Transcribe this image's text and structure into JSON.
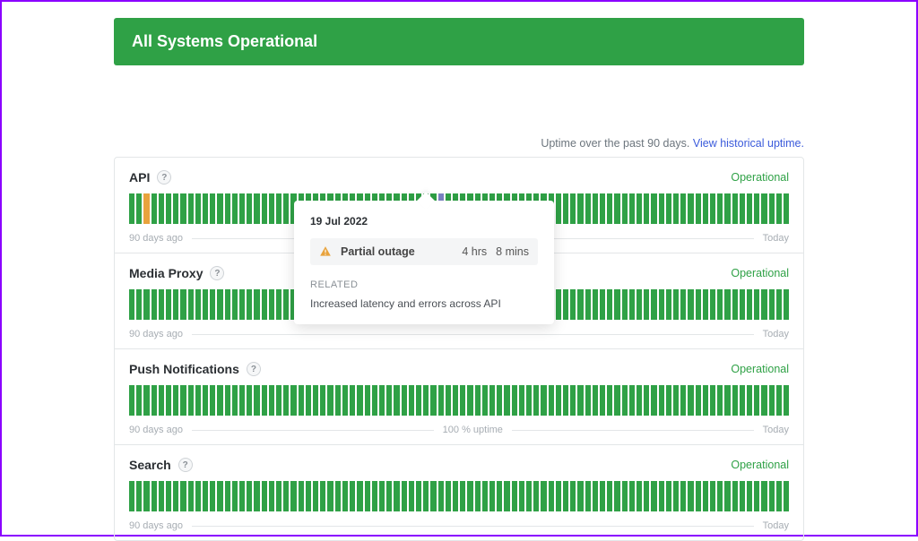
{
  "banner": {
    "title": "All Systems Operational"
  },
  "uptime_note": {
    "text": "Uptime over the past 90 days. ",
    "link": "View historical uptime."
  },
  "timeline_labels": {
    "left": "90 days ago",
    "right": "Today"
  },
  "components": [
    {
      "name": "API",
      "status": "Operational",
      "days": 90,
      "anomalies": [
        {
          "index": 2,
          "state": "degraded"
        },
        {
          "index": 42,
          "state": "partial"
        }
      ],
      "mid_label": ""
    },
    {
      "name": "Media Proxy",
      "status": "Operational",
      "days": 90,
      "anomalies": [],
      "mid_label": ""
    },
    {
      "name": "Push Notifications",
      "status": "Operational",
      "days": 90,
      "anomalies": [],
      "mid_label": "100 % uptime"
    },
    {
      "name": "Search",
      "status": "Operational",
      "days": 90,
      "anomalies": [],
      "mid_label": ""
    }
  ],
  "tooltip": {
    "visible_on_index": 0,
    "date": "19 Jul 2022",
    "status_label": "Partial outage",
    "hours": "4 hrs",
    "minutes": "8 mins",
    "related_heading": "RELATED",
    "related_text": "Increased latency and errors across API"
  }
}
